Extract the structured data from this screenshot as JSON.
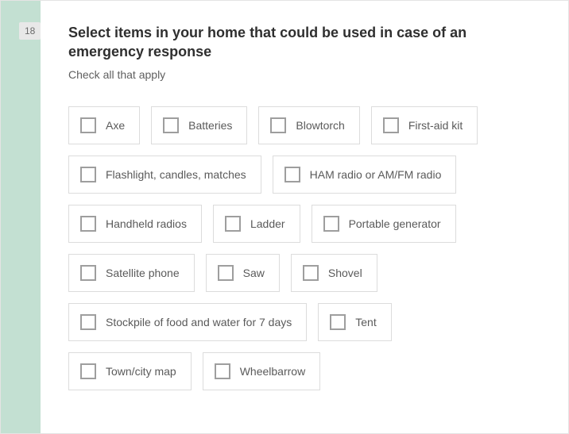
{
  "question": {
    "number": "18",
    "title": "Select items in your home that could be used in case of an emergency response",
    "hint": "Check all that apply"
  },
  "rows": [
    [
      {
        "label": "Axe"
      },
      {
        "label": "Batteries"
      },
      {
        "label": "Blowtorch"
      },
      {
        "label": "First-aid kit"
      }
    ],
    [
      {
        "label": "Flashlight, candles, matches"
      },
      {
        "label": "HAM radio or AM/FM radio"
      }
    ],
    [
      {
        "label": "Handheld radios"
      },
      {
        "label": "Ladder"
      },
      {
        "label": "Portable generator"
      }
    ],
    [
      {
        "label": "Satellite phone"
      },
      {
        "label": "Saw"
      },
      {
        "label": "Shovel"
      }
    ],
    [
      {
        "label": "Stockpile of food and water for 7 days"
      },
      {
        "label": "Tent"
      }
    ],
    [
      {
        "label": "Town/city map"
      },
      {
        "label": "Wheelbarrow"
      }
    ]
  ]
}
